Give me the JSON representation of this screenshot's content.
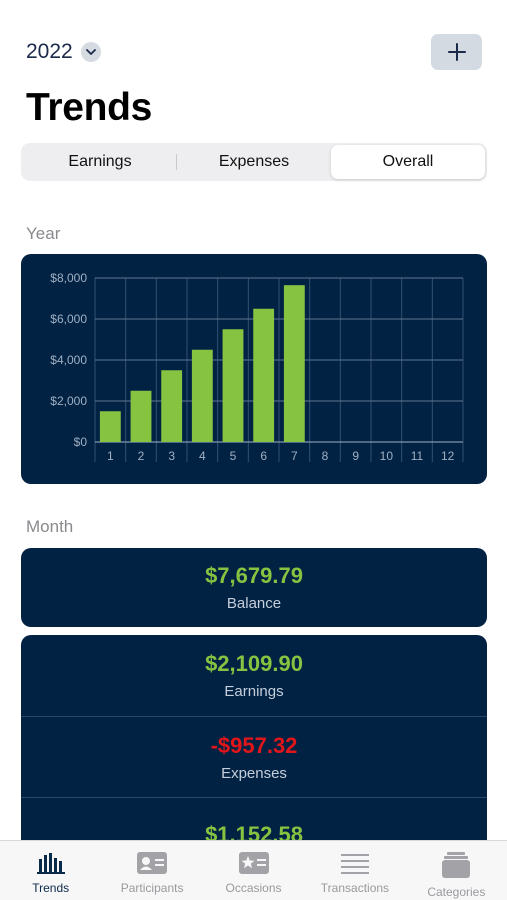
{
  "header": {
    "year": "2022",
    "title": "Trends"
  },
  "segments": [
    {
      "label": "Earnings",
      "active": false
    },
    {
      "label": "Expenses",
      "active": false
    },
    {
      "label": "Overall",
      "active": true
    }
  ],
  "sections": {
    "year": "Year",
    "month": "Month"
  },
  "chart_data": {
    "type": "bar",
    "categories": [
      "1",
      "2",
      "3",
      "4",
      "5",
      "6",
      "7",
      "8",
      "9",
      "10",
      "11",
      "12"
    ],
    "values": [
      1500,
      2500,
      3500,
      4500,
      5500,
      6500,
      7650,
      null,
      null,
      null,
      null,
      null
    ],
    "ylim": [
      0,
      8000
    ],
    "yticks": [
      0,
      2000,
      4000,
      6000,
      8000
    ],
    "ytick_labels": [
      "$0",
      "$2,000",
      "$4,000",
      "$6,000",
      "$8,000"
    ],
    "grid": true,
    "bar_color": "#86c341",
    "background": "#022244"
  },
  "balance": {
    "amount": "$7,679.79",
    "label": "Balance"
  },
  "stats": [
    {
      "amount": "$2,109.90",
      "label": "Earnings",
      "tone": "green"
    },
    {
      "amount": "-$957.32",
      "label": "Expenses",
      "tone": "red"
    },
    {
      "amount": "$1,152.58",
      "label": "",
      "tone": "green"
    }
  ],
  "tabbar": {
    "items": [
      {
        "label": "Trends",
        "icon": "bar-chart-icon",
        "active": true
      },
      {
        "label": "Participants",
        "icon": "contact-card-icon",
        "active": false
      },
      {
        "label": "Occasions",
        "icon": "star-card-icon",
        "active": false
      },
      {
        "label": "Transactions",
        "icon": "list-lines-icon",
        "active": false
      },
      {
        "label": "Categories",
        "icon": "stack-tray-icon",
        "active": false
      }
    ]
  },
  "colors": {
    "accent_green": "#86c341",
    "negative_red": "#e0161a",
    "card_navy": "#022244"
  }
}
